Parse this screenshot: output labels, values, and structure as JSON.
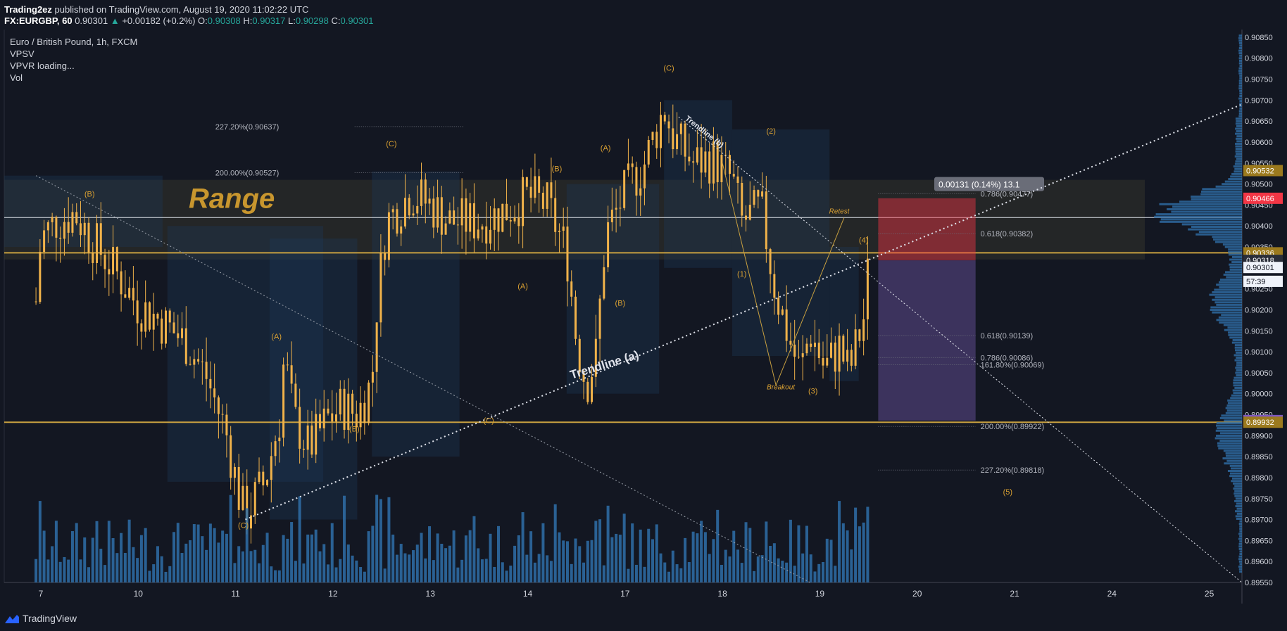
{
  "header": {
    "publisher": "Trading2ez",
    "published_text": "published on TradingView.com, August 19, 2020 11:02:22 UTC",
    "symbol": "FX:EURGBP, 60",
    "last": "0.90301",
    "change": "+0.00182 (+0.2%)",
    "o_label": "O:",
    "o_val": "0.90308",
    "h_label": "H:",
    "h_val": "0.90317",
    "l_label": "L:",
    "l_val": "0.90298",
    "c_label": "C:",
    "c_val": "0.90301"
  },
  "legend": {
    "title": "Euro / British Pound, 1h, FXCM",
    "ind1": "VPSV",
    "ind2": "VPVR loading...",
    "ind3": "Vol"
  },
  "footer": {
    "brand": "TradingView"
  },
  "colors": {
    "background": "#131722",
    "candle": "#f0b24a",
    "volume": "#2f6ea8",
    "gold": "#c8a040",
    "axis_text": "#d1d4dc",
    "badge_red": "#f23645",
    "badge_purple": "#7e57c2",
    "badge_gold": "#9c7a1e"
  },
  "chart_data": {
    "type": "candlestick",
    "title": "Euro / British Pound, 1h, FXCM",
    "ylim": [
      0.8955,
      0.90875
    ],
    "y_ticks": [
      "0.90850",
      "0.90800",
      "0.90750",
      "0.90700",
      "0.90650",
      "0.90600",
      "0.90550",
      "0.90500",
      "0.90450",
      "0.90400",
      "0.90350",
      "0.90300",
      "0.90250",
      "0.90200",
      "0.90150",
      "0.90100",
      "0.90050",
      "0.90000",
      "0.89950",
      "0.89900",
      "0.89850",
      "0.89800",
      "0.89750",
      "0.89700",
      "0.89650",
      "0.89600",
      "0.89550"
    ],
    "x_ticks": [
      {
        "label": "7",
        "day": 0
      },
      {
        "label": "10",
        "day": 1
      },
      {
        "label": "11",
        "day": 2
      },
      {
        "label": "12",
        "day": 3
      },
      {
        "label": "13",
        "day": 4
      },
      {
        "label": "14",
        "day": 5
      },
      {
        "label": "17",
        "day": 6
      },
      {
        "label": "18",
        "day": 7
      },
      {
        "label": "19",
        "day": 8
      },
      {
        "label": "20",
        "day": 9
      },
      {
        "label": "21",
        "day": 10
      },
      {
        "label": "24",
        "day": 11
      },
      {
        "label": "25",
        "day": 12
      }
    ],
    "price_badges": [
      {
        "value": "0.90532",
        "price": 0.90532,
        "style": "gold"
      },
      {
        "value": "0.90466",
        "price": 0.90466,
        "style": "red"
      },
      {
        "value": "0.90336",
        "price": 0.90336,
        "style": "gold"
      },
      {
        "value": "0.90318",
        "price": 0.90318,
        "style": "dark"
      },
      {
        "value": "0.90301",
        "price": 0.90301,
        "style": "white"
      },
      {
        "value": "57:39",
        "price": 0.90268,
        "style": "white"
      },
      {
        "value": "0.89936",
        "price": 0.89936,
        "style": "purple"
      },
      {
        "value": "0.89932",
        "price": 0.89932,
        "style": "gold"
      }
    ],
    "waypoints": [
      [
        -0.05,
        0.9022
      ],
      [
        0.0,
        0.9037
      ],
      [
        0.15,
        0.9041
      ],
      [
        0.35,
        0.9043
      ],
      [
        0.55,
        0.9036
      ],
      [
        0.8,
        0.9028
      ],
      [
        1.0,
        0.9021
      ],
      [
        1.2,
        0.9018
      ],
      [
        1.5,
        0.9012
      ],
      [
        1.7,
        0.9004
      ],
      [
        1.9,
        0.8991
      ],
      [
        2.05,
        0.8974
      ],
      [
        2.1,
        0.8971
      ],
      [
        2.3,
        0.8979
      ],
      [
        2.45,
        0.8994
      ],
      [
        2.5,
        0.9009
      ],
      [
        2.6,
        0.8994
      ],
      [
        2.75,
        0.8987
      ],
      [
        2.95,
        0.8994
      ],
      [
        3.1,
        0.8997
      ],
      [
        3.25,
        0.8995
      ],
      [
        3.4,
        0.9003
      ],
      [
        3.45,
        0.9021
      ],
      [
        3.55,
        0.9041
      ],
      [
        3.8,
        0.9048
      ],
      [
        4.0,
        0.9045
      ],
      [
        4.2,
        0.9041
      ],
      [
        4.5,
        0.9041
      ],
      [
        4.8,
        0.9044
      ],
      [
        5.0,
        0.9047
      ],
      [
        5.2,
        0.9045
      ],
      [
        5.4,
        0.9034
      ],
      [
        5.5,
        0.9013
      ],
      [
        5.6,
        0.9002
      ],
      [
        5.7,
        0.9009
      ],
      [
        5.8,
        0.9038
      ],
      [
        6.0,
        0.9048
      ],
      [
        6.2,
        0.9055
      ],
      [
        6.4,
        0.9068
      ],
      [
        6.5,
        0.9061
      ],
      [
        6.7,
        0.9055
      ],
      [
        6.9,
        0.9056
      ],
      [
        7.1,
        0.9051
      ],
      [
        7.2,
        0.9041
      ],
      [
        7.4,
        0.9044
      ],
      [
        7.5,
        0.903
      ],
      [
        7.55,
        0.9024
      ],
      [
        7.7,
        0.9012
      ],
      [
        7.8,
        0.9005
      ],
      [
        7.9,
        0.9015
      ],
      [
        8.05,
        0.9006
      ],
      [
        8.2,
        0.9011
      ],
      [
        8.3,
        0.9005
      ],
      [
        8.45,
        0.9018
      ],
      [
        8.5,
        0.903
      ]
    ],
    "horizontal_levels": [
      {
        "price": 0.90336,
        "color": "gold"
      },
      {
        "price": 0.89932,
        "color": "gold"
      },
      {
        "price": 0.9042,
        "color": "white"
      }
    ],
    "range_zone": {
      "label": "Range",
      "top": 0.9051,
      "bottom": 0.9032
    },
    "position_tool": {
      "stop_top": 0.90466,
      "entry": 0.90318,
      "target": 0.89936,
      "label": "0.00131 (0.14%) 13.1"
    },
    "fib_labels": [
      {
        "text": "227.20%(0.90637)",
        "price": 0.90637,
        "side": "left"
      },
      {
        "text": "200.00%(0.90527)",
        "price": 0.90527,
        "side": "left"
      },
      {
        "text": "0.786(0.90477)",
        "price": 0.90477,
        "side": "right"
      },
      {
        "text": "0.618(0.90382)",
        "price": 0.90382,
        "side": "right"
      },
      {
        "text": "0.618(0.90139)",
        "price": 0.90139,
        "side": "right"
      },
      {
        "text": "0.786(0.90086)",
        "price": 0.90086,
        "side": "right"
      },
      {
        "text": "161.80%(0.90069)",
        "price": 0.90069,
        "side": "right"
      },
      {
        "text": "200.00%(0.89922)",
        "price": 0.89922,
        "side": "right"
      },
      {
        "text": "227.20%(0.89818)",
        "price": 0.89818,
        "side": "right"
      }
    ],
    "wave_labels": [
      {
        "text": "(B)",
        "day": 0.5,
        "price": 0.9047
      },
      {
        "text": "(A)",
        "day": 2.42,
        "price": 0.9013
      },
      {
        "text": "(C)",
        "day": 2.08,
        "price": 0.8968
      },
      {
        "text": "(B)",
        "day": 3.22,
        "price": 0.8991
      },
      {
        "text": "(C)",
        "day": 3.6,
        "price": 0.9059
      },
      {
        "text": "(C)",
        "day": 4.6,
        "price": 0.8993
      },
      {
        "text": "(A)",
        "day": 4.95,
        "price": 0.9025
      },
      {
        "text": "(B)",
        "day": 5.3,
        "price": 0.9053
      },
      {
        "text": "(A)",
        "day": 5.8,
        "price": 0.9058
      },
      {
        "text": "(B)",
        "day": 5.95,
        "price": 0.9021
      },
      {
        "text": "(C)",
        "day": 6.45,
        "price": 0.9077
      },
      {
        "text": "(2)",
        "day": 7.5,
        "price": 0.9062
      },
      {
        "text": "(1)",
        "day": 7.2,
        "price": 0.9028
      },
      {
        "text": "(3)",
        "day": 7.93,
        "price": 0.9
      },
      {
        "text": "(4)",
        "day": 8.45,
        "price": 0.9036
      },
      {
        "text": "(5)",
        "day": 9.93,
        "price": 0.8976
      }
    ],
    "annotations": [
      {
        "text": "Retest",
        "day": 8.2,
        "price": 0.9043
      },
      {
        "text": "Breakout",
        "day": 7.6,
        "price": 0.9001
      }
    ],
    "trendline_labels": [
      {
        "text": "Trendline (a)",
        "day": 5.8,
        "price": 0.9006
      },
      {
        "text": "Trendline (b)",
        "day": 6.8,
        "price": 0.9062
      }
    ]
  }
}
